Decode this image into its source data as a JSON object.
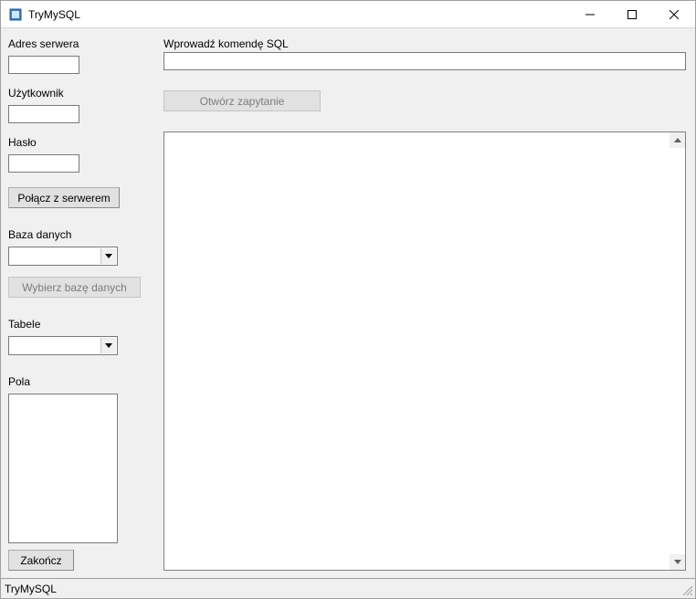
{
  "window": {
    "title": "TryMySQL"
  },
  "left": {
    "server_address_label": "Adres serwera",
    "server_address_value": "",
    "user_label": "Użytkownik",
    "user_value": "",
    "password_label": "Hasło",
    "password_value": "",
    "connect_btn": "Połącz z serwerem",
    "database_label": "Baza danych",
    "database_value": "",
    "select_db_btn": "Wybierz bazę danych",
    "tables_label": "Tabele",
    "tables_value": "",
    "fields_label": "Pola",
    "end_btn": "Zakończ"
  },
  "right": {
    "sql_label": "Wprowadź komendę SQL",
    "sql_value": "",
    "open_query_btn": "Otwórz zapytanie"
  },
  "statusbar": {
    "text": "TryMySQL"
  }
}
